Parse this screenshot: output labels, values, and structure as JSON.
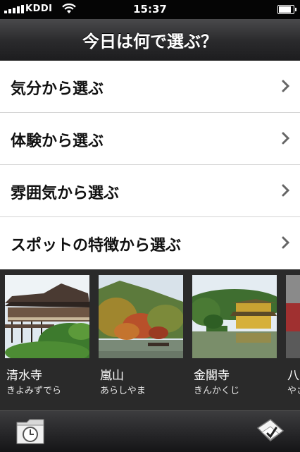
{
  "status": {
    "carrier": "KDDI",
    "time": "15:37"
  },
  "nav": {
    "title": "今日は何で選ぶ？"
  },
  "menu": [
    {
      "label": "気分から選ぶ"
    },
    {
      "label": "体験から選ぶ"
    },
    {
      "label": "雰囲気から選ぶ"
    },
    {
      "label": "スポットの特徴から選ぶ"
    }
  ],
  "gallery": [
    {
      "name": "清水寺",
      "kana": "きよみずでら"
    },
    {
      "name": "嵐山",
      "kana": "あらしやま"
    },
    {
      "name": "金閣寺",
      "kana": "きんかくじ"
    },
    {
      "name": "八",
      "kana": "やさ"
    }
  ],
  "toolbar": {
    "left_icon": "history-clock-icon",
    "right_icon": "checkbook-icon"
  }
}
